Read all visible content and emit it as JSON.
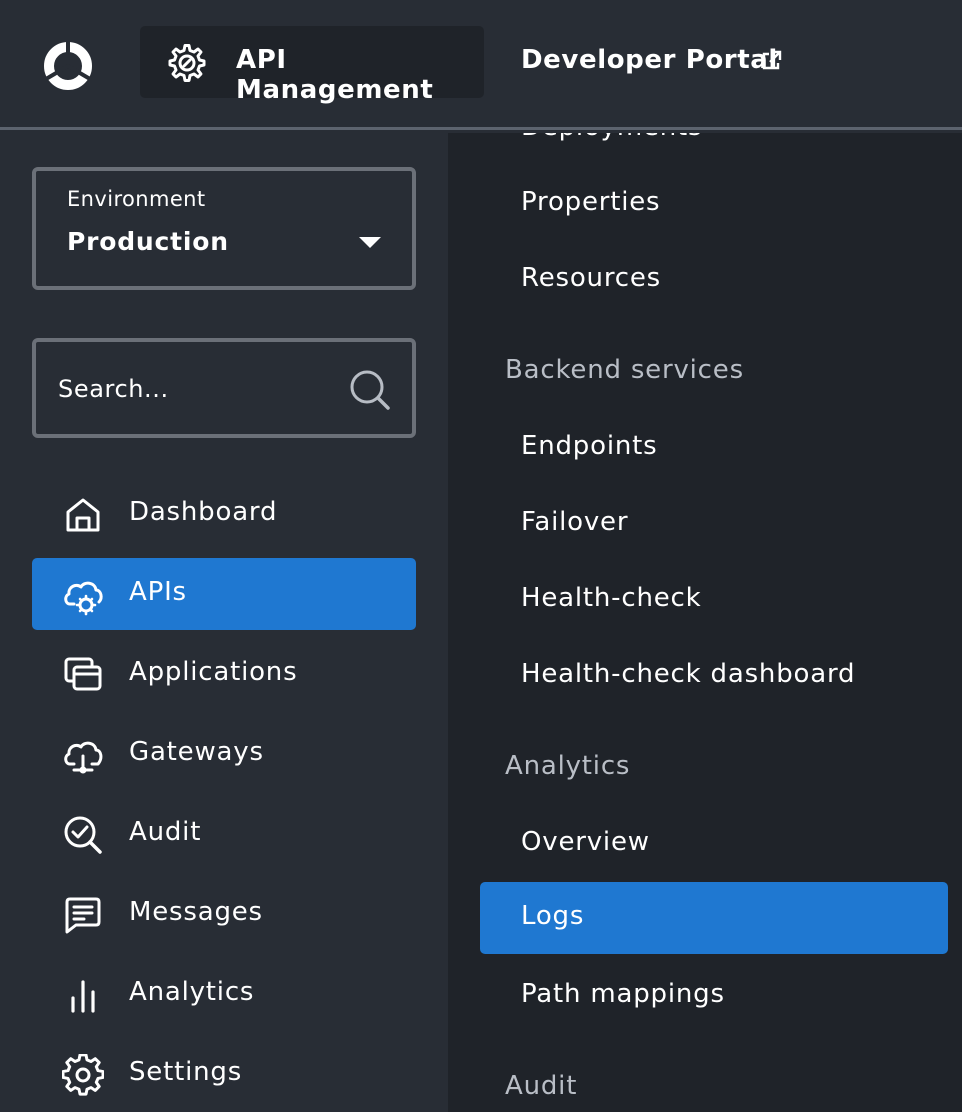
{
  "header": {
    "app_switcher_label": "API Management",
    "portal_link_label": "Developer Portal"
  },
  "environment": {
    "label": "Environment",
    "value": "Production"
  },
  "search": {
    "placeholder": "Search..."
  },
  "sidebar": {
    "items": [
      {
        "label": "Dashboard",
        "icon": "home-icon",
        "active": false
      },
      {
        "label": "APIs",
        "icon": "cloud-gear-icon",
        "active": true
      },
      {
        "label": "Applications",
        "icon": "windows-icon",
        "active": false
      },
      {
        "label": "Gateways",
        "icon": "cloud-network-icon",
        "active": false
      },
      {
        "label": "Audit",
        "icon": "magnify-check-icon",
        "active": false
      },
      {
        "label": "Messages",
        "icon": "message-icon",
        "active": false
      },
      {
        "label": "Analytics",
        "icon": "bar-chart-icon",
        "active": false
      },
      {
        "label": "Settings",
        "icon": "gear-icon",
        "active": false
      }
    ]
  },
  "submenu": {
    "partial_top_label": "Deployments",
    "items_top": [
      {
        "label": "Properties"
      },
      {
        "label": "Resources"
      }
    ],
    "sections": [
      {
        "heading": "Backend services",
        "items": [
          {
            "label": "Endpoints"
          },
          {
            "label": "Failover"
          },
          {
            "label": "Health-check"
          },
          {
            "label": "Health-check dashboard"
          }
        ]
      },
      {
        "heading": "Analytics",
        "items": [
          {
            "label": "Overview"
          },
          {
            "label": "Logs",
            "active": true
          },
          {
            "label": "Path mappings"
          }
        ]
      },
      {
        "heading": "Audit",
        "items": []
      }
    ]
  },
  "colors": {
    "accent": "#1f78d1",
    "sidebar_bg": "#282d35",
    "submenu_bg": "#1f2329",
    "heading_text": "#b9bec6"
  }
}
